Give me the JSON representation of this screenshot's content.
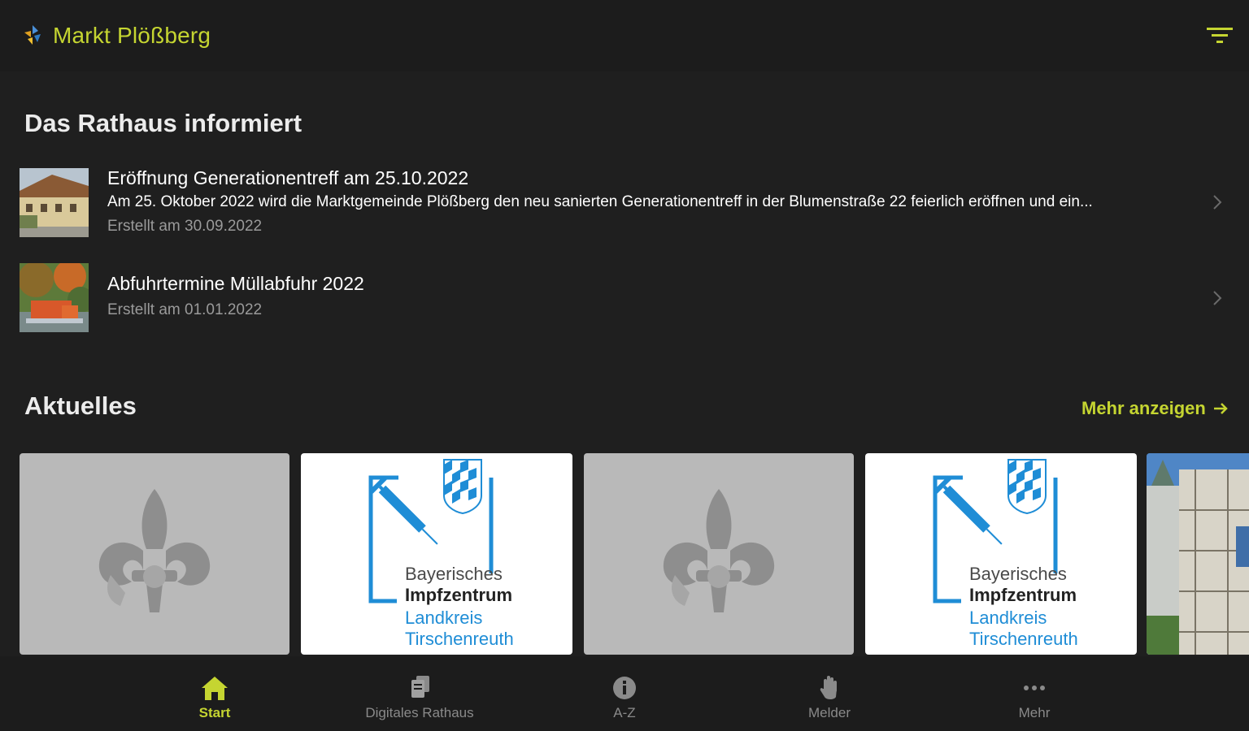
{
  "header": {
    "title": "Markt Plößberg",
    "logo_icon": "municipality-logo-icon",
    "filter_icon": "filter-icon",
    "accent_color": "#c5d531"
  },
  "rathaus": {
    "heading": "Das Rathaus informiert",
    "items": [
      {
        "title": "Eröffnung Generationentreff am 25.10.2022",
        "text": "Am 25. Oktober 2022 wird die Marktgemeinde Plößberg den neu sanierten Generationentreff in der Blumenstraße 22 feierlich eröffnen und ein...",
        "date": "Erstellt am 30.09.2022"
      },
      {
        "title": "Abfuhrtermine Müllabfuhr 2022",
        "date": "Erstellt am 01.01.2022"
      }
    ]
  },
  "aktuelles": {
    "heading": "Aktuelles",
    "more_label": "Mehr anzeigen",
    "cards": [
      {
        "kind": "placeholder"
      },
      {
        "kind": "vaccination",
        "line1": "Bayerisches",
        "line2": "Impfzentrum",
        "line3": "Landkreis",
        "line4": "Tirschenreuth"
      },
      {
        "kind": "placeholder"
      },
      {
        "kind": "vaccination",
        "line1": "Bayerisches",
        "line2": "Impfzentrum",
        "line3": "Landkreis",
        "line4": "Tirschenreuth"
      },
      {
        "kind": "photo"
      }
    ]
  },
  "nav": {
    "items": [
      {
        "label": "Start",
        "icon": "home-icon",
        "active": true
      },
      {
        "label": "Digitales Rathaus",
        "icon": "documents-icon",
        "active": false
      },
      {
        "label": "A-Z",
        "icon": "info-circle-icon",
        "active": false
      },
      {
        "label": "Melder",
        "icon": "hand-icon",
        "active": false
      },
      {
        "label": "Mehr",
        "icon": "more-dots-icon",
        "active": false
      }
    ]
  }
}
